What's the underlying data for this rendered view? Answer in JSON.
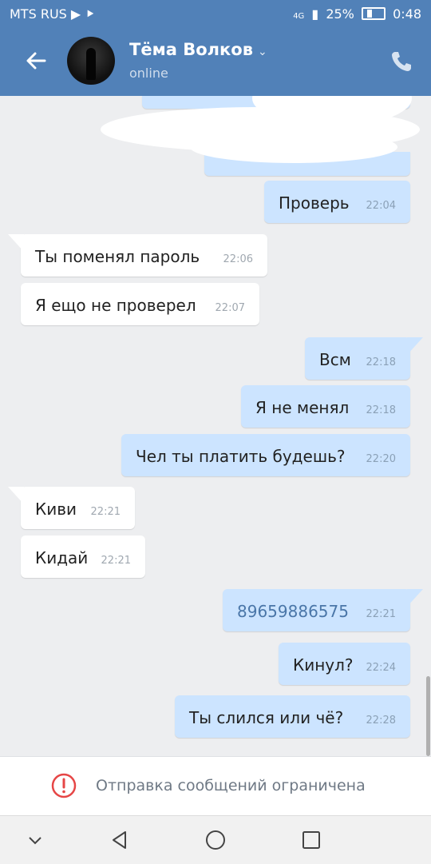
{
  "statusbar": {
    "carrier": "MTS RUS",
    "network": "4G",
    "battery": "25%",
    "battery_level": 0.25,
    "time": "0:48"
  },
  "contact": {
    "name": "Тёма Волков",
    "status": "online"
  },
  "icons": {
    "back": "arrow-left-icon",
    "phone": "phone-icon",
    "dropdown": "chevron-down-icon",
    "restrict": "exclamation-circle-icon"
  },
  "colors": {
    "header": "#5181b8",
    "outgoing": "#cce4ff",
    "incoming": "#ffffff",
    "background": "#edeef0",
    "link": "#4a76a8",
    "warning": "#e64646"
  },
  "messages": [
    {
      "dir": "out",
      "text": "Проверь",
      "time": "22:04"
    },
    {
      "dir": "in",
      "text": "Ты поменял пароль",
      "time": "22:06"
    },
    {
      "dir": "in",
      "text": "Я ещо не проверел",
      "time": "22:07"
    },
    {
      "dir": "out",
      "text": "Всм",
      "time": "22:18"
    },
    {
      "dir": "out",
      "text": "Я не менял",
      "time": "22:18"
    },
    {
      "dir": "out",
      "text": "Чел ты платить будешь?",
      "time": "22:20"
    },
    {
      "dir": "in",
      "text": "Киви",
      "time": "22:21"
    },
    {
      "dir": "in",
      "text": "Кидай",
      "time": "22:21"
    },
    {
      "dir": "out",
      "text": "89659886575",
      "time": "22:21"
    },
    {
      "dir": "out",
      "text": "Кинул?",
      "time": "22:24"
    },
    {
      "dir": "out",
      "text": "Ты слился или чё?",
      "time": "22:28"
    }
  ],
  "restriction": {
    "text": "Отправка сообщений ограничена"
  }
}
